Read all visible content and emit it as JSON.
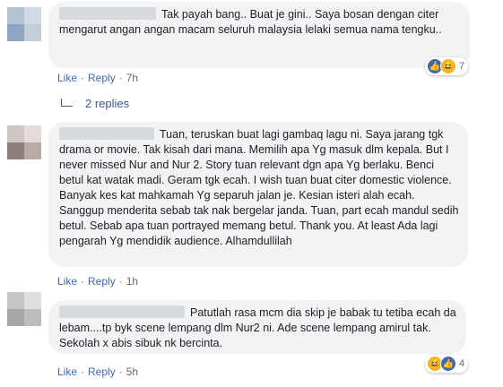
{
  "comments": [
    {
      "text": "Tak payah bang.. Buat je gini.. Saya bosan dengan citer mengarut angan angan macam seluruh malaysia lelaki semua nama tengku..",
      "like_label": "Like",
      "reply_label": "Reply",
      "time": "7h",
      "reaction_count": "7",
      "reaction_icons": [
        "like-icon",
        "haha-icon"
      ]
    },
    {
      "text": "Tuan, teruskan buat lagi gambaq lagu ni. Saya jarang tgk drama or movie. Tak kisah dari mana. Memilih apa Yg masuk dlm kepala. But I never missed Nur and Nur 2. Story tuan relevant dgn apa Yg berlaku. Benci betul kat watak madi. Geram tgk ecah. I wish tuan buat citer domestic violence. Banyak kes kat mahkamah Yg separuh jalan je. Kesian isteri alah ecah. Sanggup menderita sebab tak nak bergelar janda. Tuan, part ecah mandul sedih betul. Sebab apa tuan portrayed memang betul. Thank you. At least Ada lagi pengarah Yg mendidik audience. Alhamdullilah",
      "like_label": "Like",
      "reply_label": "Reply",
      "time": "1h"
    },
    {
      "text": "Patutlah rasa mcm dia skip je babak tu tetiba ecah da lebam....tp byk scene lempang dlm Nur2 ni. Ade scene lempang amirul tak. Sekolah x abis sibuk nk bercinta.",
      "like_label": "Like",
      "reply_label": "Reply",
      "time": "5h",
      "reaction_count": "4",
      "reaction_icons": [
        "haha-icon",
        "like-icon"
      ]
    }
  ],
  "replies_link": "2 replies",
  "colors": {
    "link": "#4267b2",
    "bubble": "#f2f3f5",
    "meta": "#606770"
  }
}
